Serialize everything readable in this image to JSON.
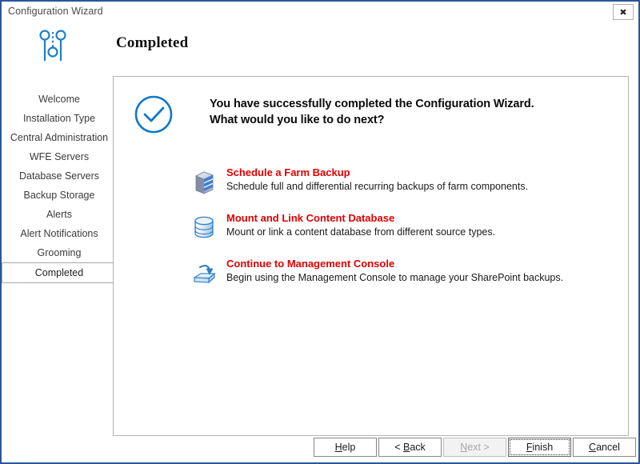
{
  "window": {
    "title": "Configuration Wizard",
    "close_label": "✖",
    "close_icon": "close-icon",
    "border_color": "#2b579a"
  },
  "header": {
    "page_title": "Completed",
    "icon": "settings-sliders-icon",
    "icon_color": "#1e7fc8"
  },
  "sidebar": {
    "items": [
      {
        "label": "Welcome",
        "selected": false
      },
      {
        "label": "Installation Type",
        "selected": false
      },
      {
        "label": "Central Administration",
        "selected": false
      },
      {
        "label": "WFE Servers",
        "selected": false
      },
      {
        "label": "Database Servers",
        "selected": false
      },
      {
        "label": "Backup Storage",
        "selected": false
      },
      {
        "label": "Alerts",
        "selected": false
      },
      {
        "label": "Alert Notifications",
        "selected": false
      },
      {
        "label": "Grooming",
        "selected": false
      },
      {
        "label": "Completed",
        "selected": true
      }
    ]
  },
  "content": {
    "success_icon": "check-circle-icon",
    "success_icon_color": "#1178c8",
    "success_line1": "You have successfully completed the Configuration Wizard.",
    "success_line2": "What would you like to do next?",
    "link_color": "#e00000",
    "actions": [
      {
        "icon": "server-stack-icon",
        "title": "Schedule a Farm Backup",
        "description": "Schedule full and differential recurring backups of farm components."
      },
      {
        "icon": "database-cylinder-icon",
        "title": "Mount and Link Content Database",
        "description": "Mount or link a content database from different source types."
      },
      {
        "icon": "inbox-download-icon",
        "title": "Continue to Management Console",
        "description": "Begin using the Management Console to manage your SharePoint backups."
      }
    ]
  },
  "buttons": {
    "help": {
      "pre": "",
      "mnemonic": "H",
      "post": "elp",
      "disabled": false,
      "focused": false
    },
    "back": {
      "pre": "< ",
      "mnemonic": "B",
      "post": "ack",
      "disabled": false,
      "focused": false
    },
    "next": {
      "pre": "",
      "mnemonic": "N",
      "post": "ext >",
      "disabled": true,
      "focused": false
    },
    "finish": {
      "pre": "",
      "mnemonic": "F",
      "post": "inish",
      "disabled": false,
      "focused": true
    },
    "cancel": {
      "pre": "",
      "mnemonic": "C",
      "post": "ancel",
      "disabled": false,
      "focused": false
    }
  }
}
